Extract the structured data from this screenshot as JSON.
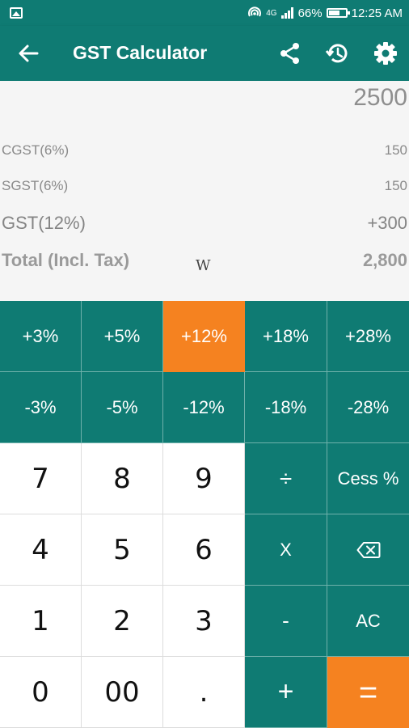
{
  "status_bar": {
    "signal_text": "4G",
    "battery_percent": "66%",
    "battery_level": 0.66,
    "time": "12:25 AM"
  },
  "app_bar": {
    "title": "GST Calculator",
    "icons": [
      "back-arrow-icon",
      "share-icon",
      "history-icon",
      "settings-icon"
    ]
  },
  "display": {
    "input": "2500",
    "rows": [
      {
        "label": "CGST(6%)",
        "value": "150"
      },
      {
        "label": "SGST(6%)",
        "value": "150"
      },
      {
        "label": "GST(12%)",
        "value": "+300"
      },
      {
        "label": "Total (Incl. Tax)",
        "value": "2,800"
      }
    ],
    "watermark": "W"
  },
  "keypad": {
    "add_rates": [
      "+3%",
      "+5%",
      "+12%",
      "+18%",
      "+28%"
    ],
    "sub_rates": [
      "-3%",
      "-5%",
      "-12%",
      "-18%",
      "-28%"
    ],
    "digits_row1": [
      "7",
      "8",
      "9"
    ],
    "digits_row2": [
      "4",
      "5",
      "6"
    ],
    "digits_row3": [
      "1",
      "2",
      "3"
    ],
    "digits_row4": [
      "0",
      "00",
      "."
    ],
    "ops": {
      "divide": "÷",
      "cess": "Cess %",
      "multiply": "X",
      "backspace_icon": "backspace-icon",
      "minus": "-",
      "clear": "AC",
      "plus": "+",
      "equals": "="
    },
    "selected_rate": "+12%"
  },
  "colors": {
    "teal": "#0f7b73",
    "orange": "#f58220",
    "display_bg": "#f5f5f5"
  }
}
